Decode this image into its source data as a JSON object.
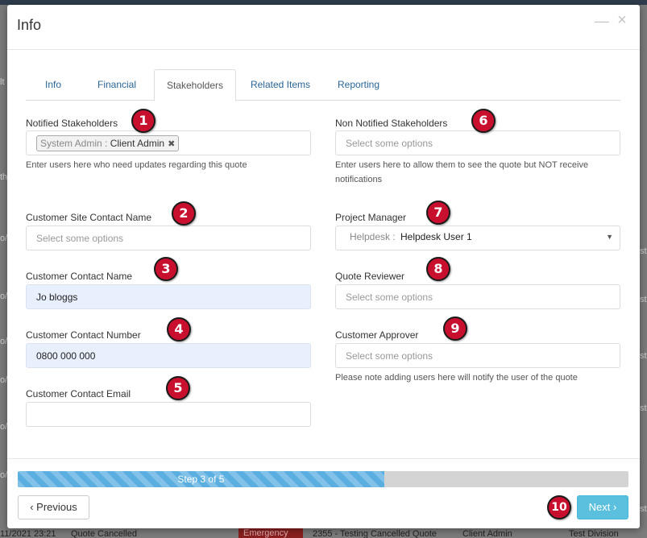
{
  "background": {
    "left_fragments": [
      "lt",
      "th",
      "o/",
      "o/",
      "o/",
      "o/",
      "o/",
      "o/"
    ],
    "right_fragments": [
      "sto",
      "sto",
      "sto",
      "sto",
      "sto"
    ],
    "bottom_row": {
      "date": "11/2021 23:21",
      "status": "Quote Cancelled",
      "priority": "Emergency",
      "quote": "2355 - Testing Cancelled Quote",
      "user": "Client Admin",
      "division": "Test Division"
    }
  },
  "modal": {
    "title": "Info",
    "minimize_glyph": "—",
    "close_glyph": "×"
  },
  "tabs": [
    {
      "label": "Info"
    },
    {
      "label": "Financial"
    },
    {
      "label": "Stakeholders"
    },
    {
      "label": "Related Items"
    },
    {
      "label": "Reporting"
    }
  ],
  "active_tab": "Stakeholders",
  "left_column": {
    "notified": {
      "label": "Notified Stakeholders",
      "tag_group": "System Admin",
      "tag_name": "Client Admin",
      "tag_remove": "✖",
      "help": "Enter users here who need updates regarding this quote"
    },
    "site_contact": {
      "label": "Customer Site Contact Name",
      "placeholder": "Select some options"
    },
    "contact_name": {
      "label": "Customer Contact Name",
      "value": "Jo bloggs"
    },
    "contact_number": {
      "label": "Customer Contact Number",
      "value": "0800 000 000"
    },
    "contact_email": {
      "label": "Customer Contact Email",
      "value": ""
    }
  },
  "right_column": {
    "non_notified": {
      "label": "Non Notified Stakeholders",
      "placeholder": "Select some options",
      "help_line1": "Enter users here to allow them to see the quote but NOT receive",
      "help_line2": "notifications"
    },
    "project_manager": {
      "label": "Project Manager",
      "group": "Helpdesk",
      "value": "Helpdesk User 1",
      "caret": "▼"
    },
    "quote_reviewer": {
      "label": "Quote Reviewer",
      "placeholder": "Select some options"
    },
    "customer_approver": {
      "label": "Customer Approver",
      "placeholder": "Select some options",
      "help": "Please note adding users here will notify the user of the quote"
    }
  },
  "annotations": [
    "1",
    "2",
    "3",
    "4",
    "5",
    "6",
    "7",
    "8",
    "9",
    "10"
  ],
  "progress": {
    "text": "Step 3 of 5",
    "fraction": 0.6
  },
  "buttons": {
    "previous": "‹ Previous",
    "next": "Next ›"
  },
  "colors": {
    "badge": "#c8102e",
    "next_button": "#5bc0de",
    "progress_fill": "#5aaee0",
    "link": "#2a6496"
  }
}
